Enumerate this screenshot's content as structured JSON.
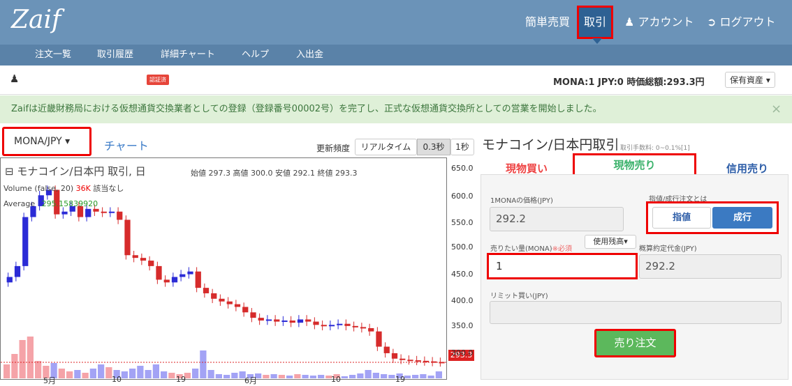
{
  "header": {
    "logo": "Zaif",
    "nav": {
      "simple_trade": "簡単売買",
      "trade": "取引",
      "account": "アカウント",
      "logout": "ログアウト"
    },
    "subnav": [
      "注文一覧",
      "取引履歴",
      "詳細チャート",
      "ヘルプ",
      "入出金"
    ]
  },
  "userbar": {
    "verified_badge": "認証済",
    "balance": "MONA:1 JPY:0 時価総額:293.3円",
    "assets_button": "保有資産 ▾"
  },
  "notice": {
    "text": "Zaifは近畿財務局における仮想通貨交換業者としての登録（登録番号00002号）を完了し、正式な仮想通貨交換所としての営業を開始しました。",
    "close": "×"
  },
  "toolbar": {
    "pair_select": "MONA/JPY ▾",
    "chart_link": "チャート",
    "update_freq_label": "更新頻度",
    "freq_options": [
      "リアルタイム",
      "0.3秒",
      "1秒"
    ]
  },
  "chart": {
    "title": "⊟ モナコイン/日本円 取引, 日",
    "ohlc": "始値 297.3 高値 300.0 安値 292.1 終値 293.3",
    "volume_label": "Volume (false, 20)",
    "volume_value": "36K",
    "volume_na": "該当なし",
    "average_label": "Average",
    "average_value": "295.15839920",
    "price_tag": "293.3"
  },
  "chart_data": {
    "type": "candlestick",
    "y_ticks": [
      "650.0",
      "600.0",
      "550.0",
      "500.0",
      "450.0",
      "400.0",
      "350.0",
      "300.0"
    ],
    "x_ticks": [
      "5月",
      "10",
      "19",
      "6月",
      "10",
      "19"
    ],
    "ylim": [
      260,
      660
    ],
    "last_price": 293.3
  },
  "trade": {
    "title": "モナコイン/日本円取引",
    "fee": "取引手数料: 0~0.1%[1]",
    "tabs": {
      "buy": "現物買い",
      "sell": "現物売り",
      "margin": "信用売り"
    },
    "price_label": "1MONAの価格(JPY)",
    "price_value": "292.2",
    "order_type_label": "指値/成行注文とは",
    "limit_button": "指値",
    "market_button": "成行",
    "amount_label": "売りたい量(MONA)",
    "required": "※必須",
    "use_balance": "使用残高▾",
    "est_label": "概算約定代金(JPY)",
    "amount_value": "1",
    "est_value": "292.2",
    "limit_buy_label": "リミット買い(JPY)",
    "submit": "売り注文"
  }
}
